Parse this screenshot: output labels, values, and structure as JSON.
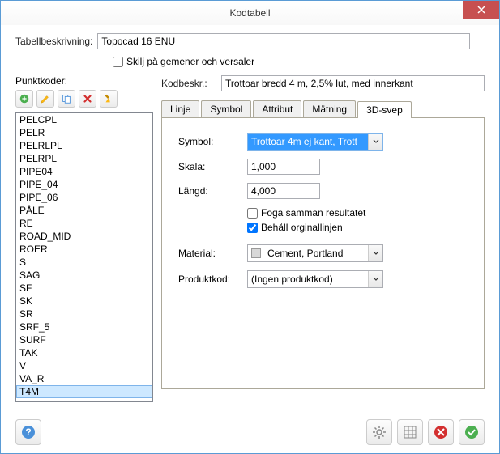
{
  "title": "Kodtabell",
  "labels": {
    "tabellbeskrivning": "Tabellbeskrivning:",
    "skilj": "Skilj på gemener och versaler",
    "punktkoder": "Punktkoder:",
    "kodbeskr": "Kodbeskr.:"
  },
  "tabellbeskrivning_value": "Topocad 16 ENU",
  "kodbeskr_value": "Trottoar bredd 4 m, 2,5% lut, med innerkant",
  "list_items": [
    "PELCPL",
    "PELR",
    "PELRLPL",
    "PELRPL",
    "PIPE04",
    "PIPE_04",
    "PIPE_06",
    "PÅLE",
    "RE",
    "ROAD_MID",
    "ROER",
    "S",
    "SAG",
    "SF",
    "SK",
    "SR",
    "SRF_5",
    "SURF",
    "TAK",
    "V",
    "VA_R",
    "T4M"
  ],
  "selected_item": "T4M",
  "tabs": [
    "Linje",
    "Symbol",
    "Attribut",
    "Mätning",
    "3D-svep"
  ],
  "active_tab": "3D-svep",
  "form": {
    "symbol_label": "Symbol:",
    "symbol_value": "Trottoar 4m ej kant, Trott",
    "skala_label": "Skala:",
    "skala_value": "1,000",
    "langd_label": "Längd:",
    "langd_value": "4,000",
    "foga": "Foga samman resultatet",
    "behall": "Behåll orginallinjen",
    "material_label": "Material:",
    "material_value": "Cement, Portland",
    "produktkod_label": "Produktkod:",
    "produktkod_value": "(Ingen produktkod)"
  }
}
